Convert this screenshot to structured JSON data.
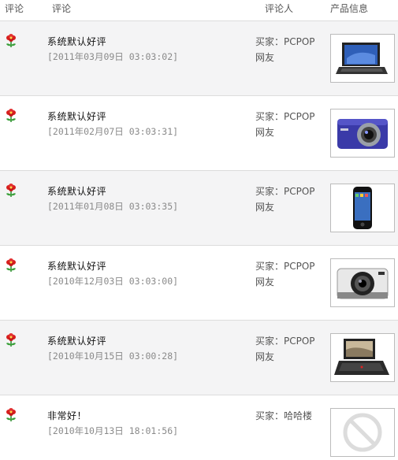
{
  "headers": {
    "rating": "评论",
    "comment": "评论",
    "reviewer": "评论人",
    "product": "产品信息"
  },
  "reviews": [
    {
      "text": "系统默认好评",
      "date": "[2011年03月09日 03:03:02]",
      "buyer": "买家：PCPOP网友",
      "product_icon": "laptop-icon"
    },
    {
      "text": "系统默认好评",
      "date": "[2011年02月07日 03:03:31]",
      "buyer": "买家：PCPOP网友",
      "product_icon": "camera-blue-icon"
    },
    {
      "text": "系统默认好评",
      "date": "[2011年01月08日 03:03:35]",
      "buyer": "买家：PCPOP网友",
      "product_icon": "phone-icon"
    },
    {
      "text": "系统默认好评",
      "date": "[2010年12月03日 03:03:00]",
      "buyer": "买家：PCPOP网友",
      "product_icon": "camera-white-icon"
    },
    {
      "text": "系统默认好评",
      "date": "[2010年10月15日 03:00:28]",
      "buyer": "买家：PCPOP网友",
      "product_icon": "tablet-laptop-icon"
    },
    {
      "text": "非常好！",
      "date": "[2010年10月13日 18:01:56]",
      "buyer": "买家：哈哈楼",
      "product_icon": "no-image-icon"
    }
  ]
}
